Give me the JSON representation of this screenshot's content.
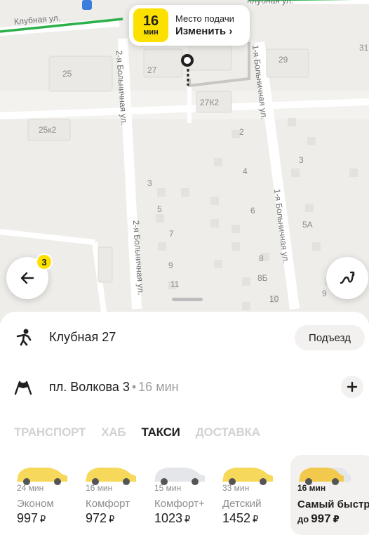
{
  "map": {
    "labels": {
      "b25": "25",
      "b27": "27",
      "b29": "29",
      "b27k2": "27К2",
      "b25k2": "25к2",
      "b2": "2",
      "b3": "3",
      "b4": "4",
      "b5": "5",
      "b6": "6",
      "b7": "7",
      "b5a": "5А",
      "b8": "8",
      "b8b": "8Б",
      "b9": "9",
      "b10": "10",
      "b11": "11",
      "b9r": "9",
      "b31": "31",
      "b3r": "3"
    },
    "streets": {
      "klubnaya": "Клубная ул.",
      "klubnaya_right": "Клубная ул.",
      "bolnichnaya2_top": "2-я Больничная ул.",
      "bolnichnaya2_bottom": "2-я Больничная ул.",
      "bolnichnaya1_top": "1-я Больничная ул.",
      "bolnichnaya1_bottom": "1-я Больничная ул."
    }
  },
  "pickup": {
    "eta_value": "16",
    "eta_unit": "мин",
    "title": "Место подачи",
    "action": "Изменить ›"
  },
  "back_badge": "3",
  "route": {
    "from": "Клубная 27",
    "entrance_button": "Подъезд",
    "to": "пл. Волкова 3",
    "separator": "•",
    "to_eta": "16 мин"
  },
  "tabs": [
    {
      "label": "Транспорт",
      "active": false
    },
    {
      "label": "Хаб",
      "active": false
    },
    {
      "label": "Такси",
      "active": true
    },
    {
      "label": "Доставка",
      "active": false
    }
  ],
  "tariffs": [
    {
      "time": "24 мин",
      "name": "Эконом",
      "price": "997",
      "currency": "₽",
      "car_color": "#f6d85a"
    },
    {
      "time": "16 мин",
      "name": "Комфорт",
      "price": "972",
      "currency": "₽",
      "car_color": "#f6d85a"
    },
    {
      "time": "15 мин",
      "name": "Комфорт+",
      "price": "1023",
      "currency": "₽",
      "car_color": "#e4e6ea"
    },
    {
      "time": "33 мин",
      "name": "Детский",
      "price": "1452",
      "currency": "₽",
      "car_color": "#f6d85a"
    },
    {
      "time": "16 мин",
      "name": "Самый быстр",
      "price_prefix": "до",
      "price": "997",
      "currency": "₽",
      "car_color": "#f2c94c",
      "selected": true
    }
  ],
  "colors": {
    "accent": "#fce000",
    "route_green": "#2bb04a",
    "map_bg": "#efedea"
  }
}
